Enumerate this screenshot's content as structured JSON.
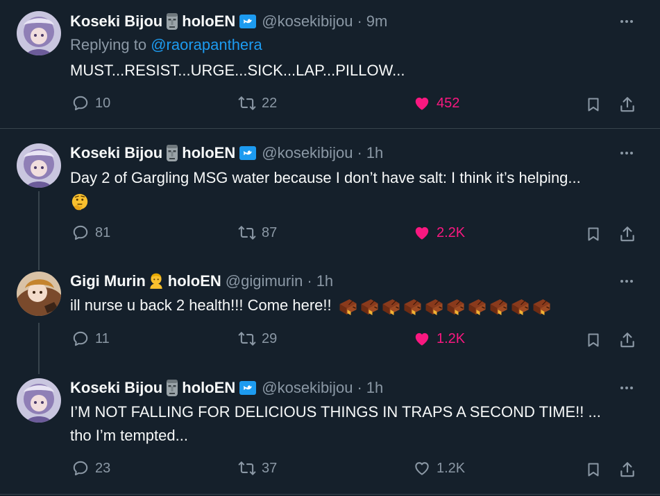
{
  "colors": {
    "background": "#15202b",
    "text": "#f7f9f9",
    "muted": "#8b98a5",
    "link": "#1d9bf0",
    "like": "#f91880",
    "divider": "#38444d"
  },
  "tweets": [
    {
      "name": "Koseki Bijou",
      "org": "holoEN",
      "handle": "@kosekibijou",
      "dot": "·",
      "time": "9m",
      "replying_prefix": "Replying to ",
      "replying_to": "@raorapanthera",
      "text": "MUST...RESIST...URGE...SICK...LAP...PILLOW...",
      "replies": "10",
      "retweets": "22",
      "likes": "452",
      "liked": true
    },
    {
      "name": "Koseki Bijou",
      "org": "holoEN",
      "handle": "@kosekibijou",
      "dot": "·",
      "time": "1h",
      "text": "Day 2 of Gargling MSG water because I don’t have salt: I think it’s helping...",
      "text_emoji": "🤔",
      "replies": "81",
      "retweets": "87",
      "likes": "2.2K",
      "liked": true
    },
    {
      "name": "Gigi Murin",
      "org": "holoEN",
      "handle": "@gigimurin",
      "dot": "·",
      "time": "1h",
      "text": "ill nurse u back 2 health!!! Come here!!",
      "replies": "11",
      "retweets": "29",
      "likes": "1.2K",
      "liked": true
    },
    {
      "name": "Koseki Bijou",
      "org": "holoEN",
      "handle": "@kosekibijou",
      "dot": "·",
      "time": "1h",
      "text": "I’M NOT FALLING FOR DELICIOUS THINGS IN TRAPS A SECOND TIME!! ...",
      "text_line2": "tho I’m tempted...",
      "replies": "23",
      "retweets": "37",
      "likes": "1.2K",
      "liked": false
    }
  ],
  "icons": {
    "moai": "moai-icon",
    "verified": "verified-badge-icon",
    "person": "person-emoji-icon",
    "reply": "reply-icon",
    "retweet": "retweet-icon",
    "like": "heart-icon",
    "bookmark": "bookmark-icon",
    "share": "share-icon",
    "more": "more-icon",
    "trap": "trap-box-icon"
  }
}
